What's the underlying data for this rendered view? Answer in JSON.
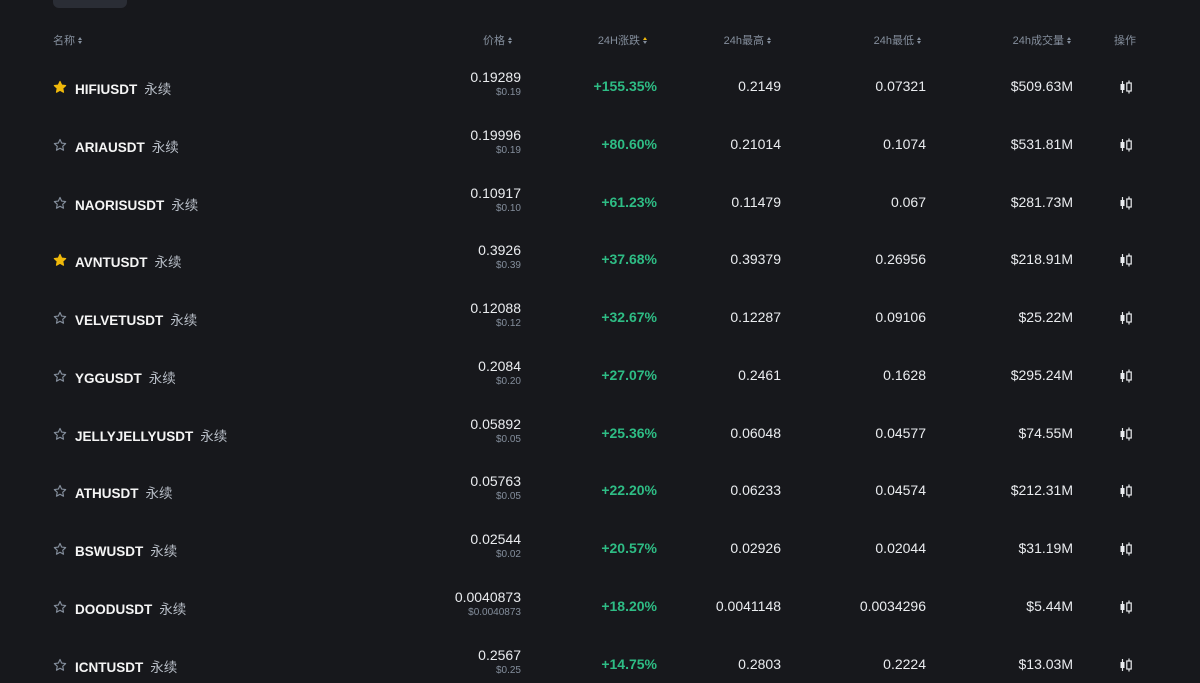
{
  "header": {
    "name": "名称",
    "price": "价格",
    "change": "24H涨跌",
    "high": "24h最高",
    "low": "24h最低",
    "volume": "24h成交量",
    "action": "操作"
  },
  "colors": {
    "background": "#17181c",
    "positive": "#2ebd85",
    "star_active": "#f0b90b",
    "muted": "#848e9c"
  },
  "rows": [
    {
      "favorite": true,
      "symbol": "HIFIUSDT",
      "tag": "永续",
      "price": "0.19289",
      "price_usd": "$0.19",
      "change": "+155.35%",
      "high": "0.2149",
      "low": "0.07321",
      "volume": "$509.63M"
    },
    {
      "favorite": false,
      "symbol": "ARIAUSDT",
      "tag": "永续",
      "price": "0.19996",
      "price_usd": "$0.19",
      "change": "+80.60%",
      "high": "0.21014",
      "low": "0.1074",
      "volume": "$531.81M"
    },
    {
      "favorite": false,
      "symbol": "NAORISUSDT",
      "tag": "永续",
      "price": "0.10917",
      "price_usd": "$0.10",
      "change": "+61.23%",
      "high": "0.11479",
      "low": "0.067",
      "volume": "$281.73M"
    },
    {
      "favorite": true,
      "symbol": "AVNTUSDT",
      "tag": "永续",
      "price": "0.3926",
      "price_usd": "$0.39",
      "change": "+37.68%",
      "high": "0.39379",
      "low": "0.26956",
      "volume": "$218.91M"
    },
    {
      "favorite": false,
      "symbol": "VELVETUSDT",
      "tag": "永续",
      "price": "0.12088",
      "price_usd": "$0.12",
      "change": "+32.67%",
      "high": "0.12287",
      "low": "0.09106",
      "volume": "$25.22M"
    },
    {
      "favorite": false,
      "symbol": "YGGUSDT",
      "tag": "永续",
      "price": "0.2084",
      "price_usd": "$0.20",
      "change": "+27.07%",
      "high": "0.2461",
      "low": "0.1628",
      "volume": "$295.24M"
    },
    {
      "favorite": false,
      "symbol": "JELLYJELLYUSDT",
      "tag": "永续",
      "price": "0.05892",
      "price_usd": "$0.05",
      "change": "+25.36%",
      "high": "0.06048",
      "low": "0.04577",
      "volume": "$74.55M"
    },
    {
      "favorite": false,
      "symbol": "ATHUSDT",
      "tag": "永续",
      "price": "0.05763",
      "price_usd": "$0.05",
      "change": "+22.20%",
      "high": "0.06233",
      "low": "0.04574",
      "volume": "$212.31M"
    },
    {
      "favorite": false,
      "symbol": "BSWUSDT",
      "tag": "永续",
      "price": "0.02544",
      "price_usd": "$0.02",
      "change": "+20.57%",
      "high": "0.02926",
      "low": "0.02044",
      "volume": "$31.19M"
    },
    {
      "favorite": false,
      "symbol": "DOODUSDT",
      "tag": "永续",
      "price": "0.0040873",
      "price_usd": "$0.0040873",
      "change": "+18.20%",
      "high": "0.0041148",
      "low": "0.0034296",
      "volume": "$5.44M"
    },
    {
      "favorite": false,
      "symbol": "ICNTUSDT",
      "tag": "永续",
      "price": "0.2567",
      "price_usd": "$0.25",
      "change": "+14.75%",
      "high": "0.2803",
      "low": "0.2224",
      "volume": "$13.03M"
    }
  ]
}
